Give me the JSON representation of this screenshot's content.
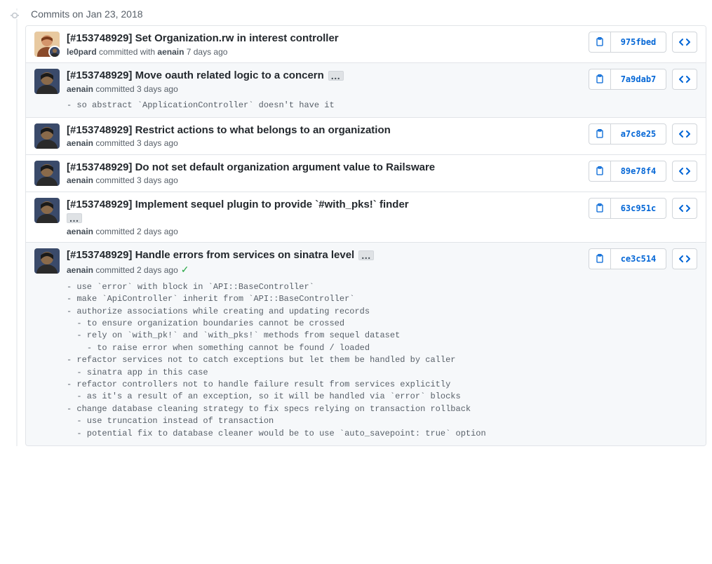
{
  "group_title": "Commits on Jan 23, 2018",
  "commits": [
    {
      "title": "[#153748929] Set Organization.rw in interest controller",
      "author": "le0pard",
      "meta_after_author": " committed with ",
      "committer": "aenain",
      "time": " 7 days ago",
      "hash": "975fbed",
      "avatar_type": "light",
      "has_sub_avatar": true,
      "has_expand": false,
      "expanded": false,
      "verified": false,
      "body": ""
    },
    {
      "title": "[#153748929] Move oauth related logic to a concern",
      "author": "aenain",
      "meta_after_author": " committed ",
      "committer": "",
      "time": "3 days ago",
      "hash": "7a9dab7",
      "avatar_type": "dark",
      "has_sub_avatar": false,
      "has_expand": true,
      "expanded": true,
      "verified": false,
      "body": "- so abstract `ApplicationController` doesn't have it"
    },
    {
      "title": "[#153748929] Restrict actions to what belongs to an organization",
      "author": "aenain",
      "meta_after_author": " committed ",
      "committer": "",
      "time": "3 days ago",
      "hash": "a7c8e25",
      "avatar_type": "dark",
      "has_sub_avatar": false,
      "has_expand": false,
      "expanded": false,
      "verified": false,
      "body": ""
    },
    {
      "title": "[#153748929] Do not set default organization argument value to Railsware",
      "author": "aenain",
      "meta_after_author": " committed ",
      "committer": "",
      "time": "3 days ago",
      "hash": "89e78f4",
      "avatar_type": "dark",
      "has_sub_avatar": false,
      "has_expand": false,
      "expanded": false,
      "verified": false,
      "body": ""
    },
    {
      "title": "[#153748929] Implement sequel plugin to provide `#with_pks!` finder",
      "author": "aenain",
      "meta_after_author": " committed ",
      "committer": "",
      "time": "2 days ago",
      "hash": "63c951c",
      "avatar_type": "dark",
      "has_sub_avatar": false,
      "has_expand": true,
      "expanded": false,
      "verified": false,
      "body": ""
    },
    {
      "title": "[#153748929] Handle errors from services on sinatra level",
      "author": "aenain",
      "meta_after_author": " committed ",
      "committer": "",
      "time": "2 days ago",
      "hash": "ce3c514",
      "avatar_type": "dark",
      "has_sub_avatar": false,
      "has_expand": true,
      "expanded": true,
      "verified": true,
      "body": "- use `error` with block in `API::BaseController`\n- make `ApiController` inherit from `API::BaseController`\n- authorize associations while creating and updating records\n  - to ensure organization boundaries cannot be crossed\n  - rely on `with_pk!` and `with_pks!` methods from sequel dataset\n    - to raise error when something cannot be found / loaded\n- refactor services not to catch exceptions but let them be handled by caller\n  - sinatra app in this case\n- refactor controllers not to handle failure result from services explicitly\n  - as it's a result of an exception, so it will be handled via `error` blocks\n- change database cleaning strategy to fix specs relying on transaction rollback\n  - use truncation instead of transaction\n  - potential fix to database cleaner would be to use `auto_savepoint: true` option"
    }
  ]
}
